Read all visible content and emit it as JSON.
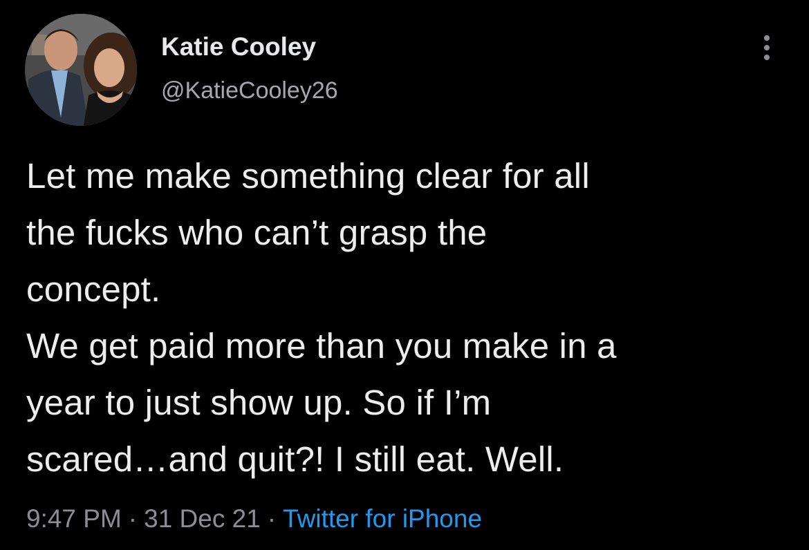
{
  "author": {
    "name": "Katie Cooley",
    "handle": "@KatieCooley26",
    "avatar_icon": "profile-photo"
  },
  "more_icon": "more-options-icon",
  "tweet": {
    "lines": [
      "Let me make something clear for all",
      "the fucks who can’t grasp the",
      "concept.",
      "We get paid more than you make in a",
      "year to just show up. So if I’m",
      "scared…and quit?! I still eat. Well."
    ]
  },
  "meta": {
    "time": "9:47 PM",
    "separator": "·",
    "date": "31 Dec 21",
    "source": "Twitter for iPhone"
  },
  "colors": {
    "background": "#000000",
    "text": "#e7e9ea",
    "secondary": "#8b8f93",
    "link": "#1d9bf0"
  }
}
